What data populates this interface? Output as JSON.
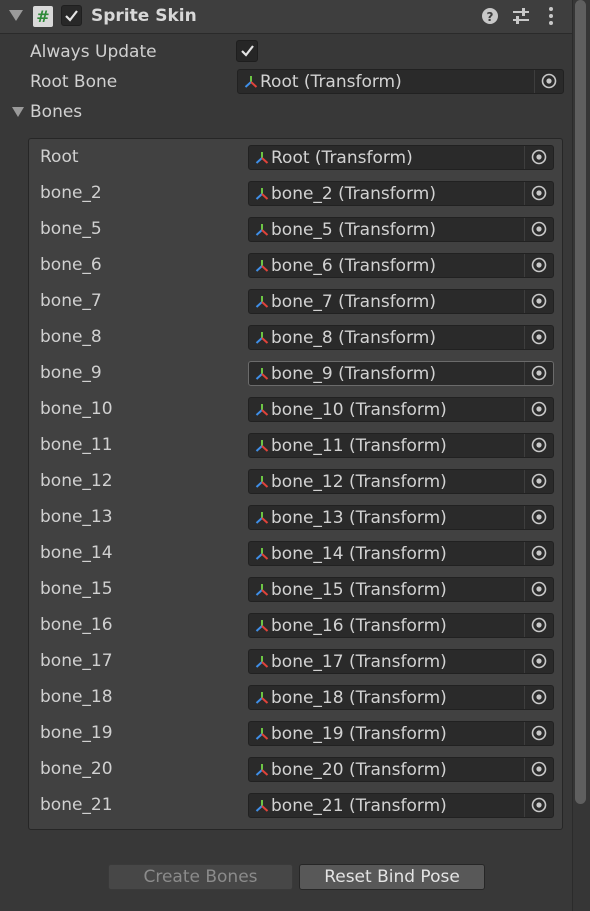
{
  "component": {
    "title": "Sprite Skin",
    "enabled": true,
    "script_icon_glyph": "#"
  },
  "properties": {
    "always_update_label": "Always Update",
    "always_update_checked": true,
    "root_bone_label": "Root Bone",
    "root_bone_value": "Root (Transform)",
    "bones_label": "Bones"
  },
  "bones": [
    {
      "label": "Root",
      "value": "Root (Transform)"
    },
    {
      "label": "bone_2",
      "value": "bone_2 (Transform)"
    },
    {
      "label": "bone_5",
      "value": "bone_5 (Transform)"
    },
    {
      "label": "bone_6",
      "value": "bone_6 (Transform)"
    },
    {
      "label": "bone_7",
      "value": "bone_7 (Transform)"
    },
    {
      "label": "bone_8",
      "value": "bone_8 (Transform)"
    },
    {
      "label": "bone_9",
      "value": "bone_9 (Transform)",
      "highlighted": true
    },
    {
      "label": "bone_10",
      "value": "bone_10 (Transform)"
    },
    {
      "label": "bone_11",
      "value": "bone_11 (Transform)"
    },
    {
      "label": "bone_12",
      "value": "bone_12 (Transform)"
    },
    {
      "label": "bone_13",
      "value": "bone_13 (Transform)"
    },
    {
      "label": "bone_14",
      "value": "bone_14 (Transform)"
    },
    {
      "label": "bone_15",
      "value": "bone_15 (Transform)"
    },
    {
      "label": "bone_16",
      "value": "bone_16 (Transform)"
    },
    {
      "label": "bone_17",
      "value": "bone_17 (Transform)"
    },
    {
      "label": "bone_18",
      "value": "bone_18 (Transform)"
    },
    {
      "label": "bone_19",
      "value": "bone_19 (Transform)"
    },
    {
      "label": "bone_20",
      "value": "bone_20 (Transform)"
    },
    {
      "label": "bone_21",
      "value": "bone_21 (Transform)"
    }
  ],
  "buttons": {
    "create_bones": "Create Bones",
    "create_bones_enabled": false,
    "reset_bind_pose": "Reset Bind Pose"
  },
  "icons": {
    "foldout": "foldout-triangle-icon",
    "script": "csharp-script-icon",
    "help": "help-icon",
    "presets": "presets-sliders-icon",
    "menu": "kebab-menu-icon",
    "transform": "transform-axes-icon",
    "picker": "object-picker-icon",
    "check": "checkmark-icon"
  },
  "colors": {
    "background": "#383838",
    "field": "#2a2a2a",
    "axis_red": "#e0433a",
    "axis_green": "#6cc644",
    "axis_blue": "#3f8fe8"
  }
}
